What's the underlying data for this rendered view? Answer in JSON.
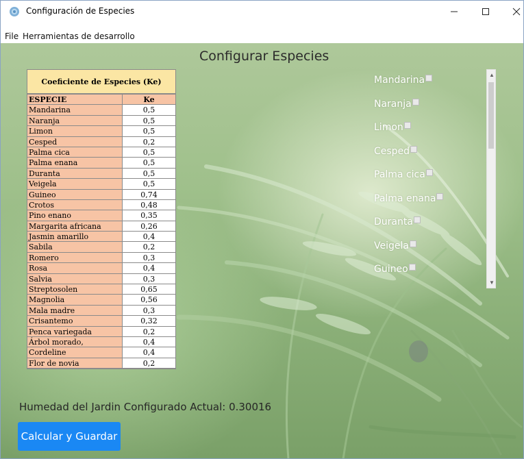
{
  "window": {
    "title": "Configuración de Especies",
    "minimize_label": "—",
    "maximize_label": "☐",
    "close_label": "✕"
  },
  "menu": {
    "file_label": "File",
    "tools_label": "Herramientas de desarrollo"
  },
  "page_title": "Configurar Especies",
  "coef_table": {
    "caption": "Coeficiente de Especies  (Ke)",
    "col_species": "ESPECIE",
    "col_ke": "Ke",
    "rows": [
      {
        "species": "Mandarina",
        "ke": "0,5"
      },
      {
        "species": "Naranja",
        "ke": "0,5"
      },
      {
        "species": "Limon",
        "ke": "0,5"
      },
      {
        "species": "Cesped",
        "ke": "0,2"
      },
      {
        "species": "Palma cica",
        "ke": "0,5"
      },
      {
        "species": "Palma enana",
        "ke": "0,5"
      },
      {
        "species": "Duranta",
        "ke": "0,5"
      },
      {
        "species": "Veigela",
        "ke": "0,5"
      },
      {
        "species": "Guineo",
        "ke": "0,74"
      },
      {
        "species": "Crotos",
        "ke": "0,48"
      },
      {
        "species": "Pino enano",
        "ke": "0,35"
      },
      {
        "species": "Margarita africana",
        "ke": "0,26"
      },
      {
        "species": "Jasmin amarillo",
        "ke": "0,4"
      },
      {
        "species": "Sabila",
        "ke": "0,2"
      },
      {
        "species": "Romero",
        "ke": "0,3"
      },
      {
        "species": "Rosa",
        "ke": "0,4"
      },
      {
        "species": "Salvia",
        "ke": "0,3"
      },
      {
        "species": "Streptosolen",
        "ke": "0,65"
      },
      {
        "species": "Magnolia",
        "ke": "0,56"
      },
      {
        "species": "Mala madre",
        "ke": "0,3"
      },
      {
        "species": "Crisantemo",
        "ke": "0,32"
      },
      {
        "species": "Penca variegada",
        "ke": "0,2"
      },
      {
        "species": "Árbol morado,",
        "ke": "0,4"
      },
      {
        "species": "Cordeline",
        "ke": "0,4"
      },
      {
        "species": "Flor de novia",
        "ke": "0,2"
      }
    ]
  },
  "species_list": [
    {
      "label": "Mandarina",
      "checked": false
    },
    {
      "label": "Naranja",
      "checked": false
    },
    {
      "label": "Limon",
      "checked": false
    },
    {
      "label": "Cesped",
      "checked": false
    },
    {
      "label": "Palma cica",
      "checked": false
    },
    {
      "label": "Palma enana",
      "checked": false
    },
    {
      "label": "Duranta",
      "checked": false
    },
    {
      "label": "Veigela",
      "checked": false
    },
    {
      "label": "Guineo",
      "checked": false
    }
  ],
  "humidity_text": "Humedad del Jardin Configurado Actual: 0.30016",
  "save_button_label": "Calcular y Guardar",
  "colors": {
    "button": "#1a88f4",
    "table_label_bg": "#f7c4a5",
    "table_caption_bg": "#fbe6a4"
  }
}
